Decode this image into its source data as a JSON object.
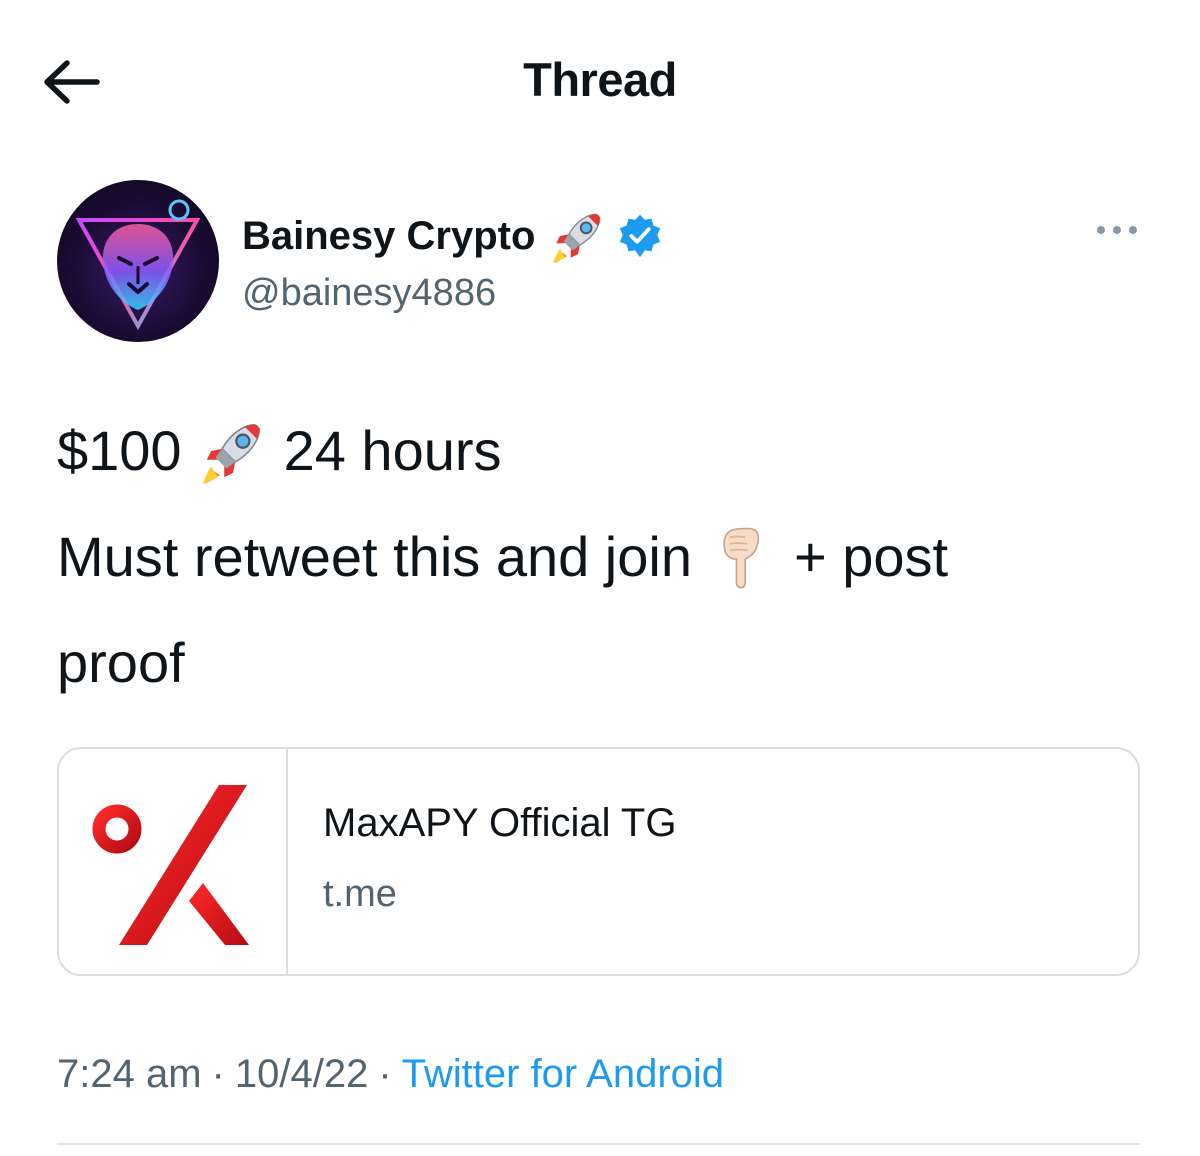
{
  "header": {
    "title": "Thread",
    "back_icon": "arrow-left-icon"
  },
  "author": {
    "display_name": "Bainesy Crypto",
    "name_emoji": "rocket",
    "verified_icon": "verified-badge-icon",
    "handle": "@bainesy4886",
    "more_icon": "more-horizontal-icon"
  },
  "tweet": {
    "line1_before": "$100",
    "line1_emoji": "rocket",
    "line1_after": "24 hours",
    "line2_before": "Must retweet this and join",
    "line2_emoji": "pointing-down-hand",
    "line2_after": "+ post",
    "line3": "proof"
  },
  "link_card": {
    "title": "MaxAPY Official TG",
    "domain": "t.me",
    "thumbnail_icon": "percent-logo-icon"
  },
  "meta": {
    "time": "7:24 am",
    "separator": "·",
    "date": "10/4/22",
    "source": "Twitter for Android"
  },
  "colors": {
    "text": "#0f1419",
    "secondary": "#536471",
    "accent": "#1d9bf0",
    "logo_red": "#d8141c"
  }
}
